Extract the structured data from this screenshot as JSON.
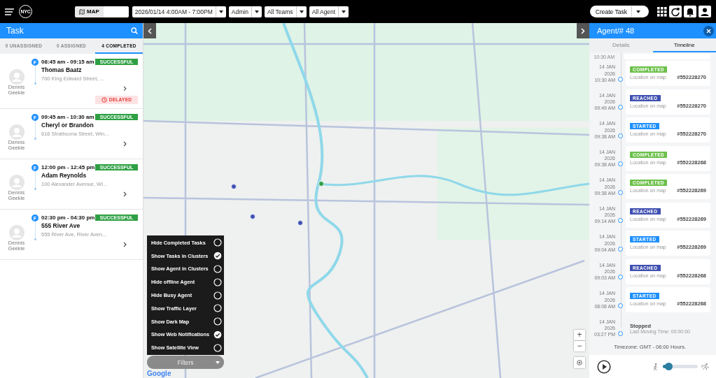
{
  "top_bar": {
    "logo": "NYC",
    "map_button": "MAP",
    "date_range": "2026/01/14 4:00AM - 7:00PM",
    "role_filter": "Admin",
    "team_filter": "All Teams",
    "agent_filter": "All Agent",
    "create_button": "Create Task"
  },
  "task_panel": {
    "title": "Task",
    "tabs": [
      {
        "label": "0 UNASSIGNED",
        "selected": false
      },
      {
        "label": "0 ASSIGNED",
        "selected": false
      },
      {
        "label": "4 COMPLETED",
        "selected": true
      }
    ],
    "tasks": [
      {
        "agent": "Dennis Geekie",
        "badge": "F",
        "time": "08:45 am - 09:15 am",
        "name": "Thomas Baatz",
        "address": "700 King Edward Street, ...",
        "status": "SUCCESSFUL",
        "delay_label": "DELAYED"
      },
      {
        "agent": "Dennis Geekie",
        "badge": "F",
        "time": "09:45 am - 10:30 am",
        "name": "Cheryl or Brandon",
        "address": "616 Strathcona Street, Win...",
        "status": "SUCCESSFUL"
      },
      {
        "agent": "Dennis Geekie",
        "badge": "F",
        "time": "12:00 pm - 12:45 pm",
        "name": "Adam Reynolds",
        "address": "100 Alexander Avenue, Wi...",
        "status": "SUCCESSFUL"
      },
      {
        "agent": "Dennis Geekie",
        "badge": "F",
        "time": "02:30 pm - 04:30 pm",
        "name": "555 River Ave",
        "address": "555 River Ave, River Aven...",
        "status": "SUCCESSFUL"
      }
    ]
  },
  "map": {
    "attribution": "Google",
    "filters": [
      {
        "label": "Hide Completed Tasks",
        "checked": false
      },
      {
        "label": "Show Tasks in Clusters",
        "checked": true
      },
      {
        "label": "Show Agent in Clusters",
        "checked": false
      },
      {
        "label": "Hide offline Agent",
        "checked": false
      },
      {
        "label": "Hide Busy Agent",
        "checked": false
      },
      {
        "label": "Show Traffic Layer",
        "checked": false
      },
      {
        "label": "Show Dark Map",
        "checked": false
      },
      {
        "label": "Show Web Notifications",
        "checked": true
      },
      {
        "label": "Show Satellite View",
        "checked": false
      }
    ],
    "filters_button": "Filters",
    "zoom_in": "+",
    "zoom_out": "−"
  },
  "agent_panel": {
    "title": "Agent/# 48",
    "tabs": [
      {
        "label": "Details",
        "selected": false
      },
      {
        "label": "Timeline",
        "selected": true
      }
    ],
    "timeline_top_cut": "10:30 AM",
    "timeline": [
      {
        "kind": "completed",
        "date": "14 JAN 2026",
        "time": "10:30 AM",
        "status": "COMPLETED",
        "location": "Location on map",
        "task_id": "#552228270"
      },
      {
        "kind": "reached",
        "date": "14 JAN 2026",
        "time": "09:49 AM",
        "status": "REACHED",
        "location": "Location on map",
        "task_id": "#552228270"
      },
      {
        "kind": "started",
        "date": "14 JAN 2026",
        "time": "09:38 AM",
        "status": "STARTED",
        "location": "Location on map",
        "task_id": "#552228270"
      },
      {
        "kind": "completed",
        "date": "14 JAN 2026",
        "time": "09:38 AM",
        "status": "COMPLETED",
        "location": "Location on map",
        "task_id": "#552228268"
      },
      {
        "kind": "completed",
        "date": "14 JAN 2026",
        "time": "09:38 AM",
        "status": "COMPLETED",
        "location": "Location on map",
        "task_id": "#552228269"
      },
      {
        "kind": "reached",
        "date": "14 JAN 2026",
        "time": "09:14 AM",
        "status": "REACHED",
        "location": "Location on map",
        "task_id": "#552228269"
      },
      {
        "kind": "started",
        "date": "14 JAN 2026",
        "time": "09:04 AM",
        "status": "STARTED",
        "location": "Location on map",
        "task_id": "#552228269"
      },
      {
        "kind": "reached",
        "date": "14 JAN 2026",
        "time": "09:03 AM",
        "status": "REACHED",
        "location": "Location on map",
        "task_id": "#552228268"
      },
      {
        "kind": "started",
        "date": "14 JAN 2026",
        "time": "08:08 AM",
        "status": "STARTED",
        "location": "Location on map",
        "task_id": "#552228268"
      },
      {
        "kind": "stopped",
        "date": "14 JAN 2026",
        "time": "03:27 PM",
        "status": "Stopped",
        "location": "Last Moving Time: 00:00:00"
      }
    ],
    "timezone": "Timezone: GMT - 06:00 Hours.",
    "playback": {
      "level": 0.15
    }
  }
}
